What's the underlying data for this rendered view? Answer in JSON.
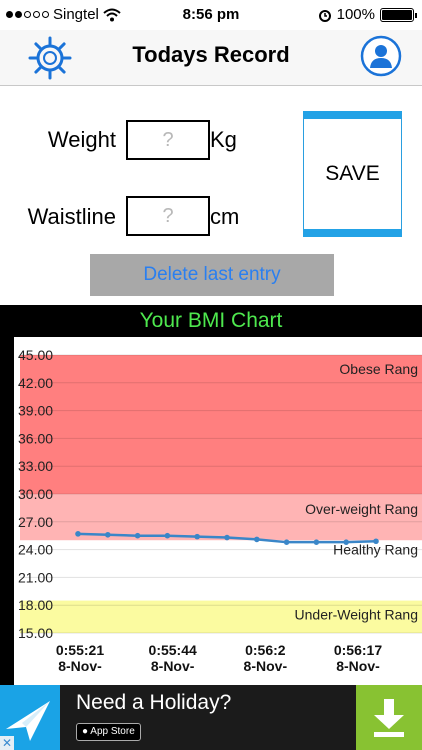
{
  "status_bar": {
    "carrier": "Singtel",
    "time": "8:56 pm",
    "battery": "100%"
  },
  "nav": {
    "title": "Todays Record",
    "left_icon": "settings-gear-icon",
    "right_icon": "user-profile-icon"
  },
  "form": {
    "weight_label": "Weight",
    "weight_placeholder": "?",
    "weight_value": "",
    "weight_unit": "Kg",
    "waist_label": "Waistline",
    "waist_placeholder": "?",
    "waist_value": "",
    "waist_unit": "cm",
    "save_label": "SAVE",
    "delete_label": "Delete last entry"
  },
  "chart_panel_title": "Your BMI Chart",
  "chart_data": {
    "type": "line",
    "title": "Your BMI Chart",
    "ylim": [
      15,
      45
    ],
    "yticks": [
      "45.00",
      "42.00",
      "39.00",
      "36.00",
      "33.00",
      "30.00",
      "27.00",
      "24.00",
      "21.00",
      "18.00",
      "15.00"
    ],
    "bands": [
      {
        "name": "Obese Range",
        "from": 30,
        "to": 45,
        "color": "#ff7f7f"
      },
      {
        "name": "Over-weight Range",
        "from": 25,
        "to": 30,
        "color": "#ffb4b4"
      },
      {
        "name": "Healthy Range",
        "from": 18.5,
        "to": 25,
        "color": "#ffffff"
      },
      {
        "name": "Under-Weight Range",
        "from": 15,
        "to": 18.5,
        "color": "#fbfba0"
      }
    ],
    "band_labels": [
      "Obese Rang",
      "Over-weight Rang",
      "Healthy Rang",
      "Under-Weight Rang"
    ],
    "xtick_labels": [
      {
        "time": "0:55:21",
        "date": "8-Nov-"
      },
      {
        "time": "0:55:44",
        "date": "8-Nov-"
      },
      {
        "time": "0:56:2",
        "date": "8-Nov-"
      },
      {
        "time": "0:56:17",
        "date": "8-Nov-"
      }
    ],
    "series": [
      {
        "values": [
          25.7,
          25.6,
          25.5,
          25.5,
          25.4,
          25.3,
          25.1,
          24.8,
          24.8,
          24.8,
          24.9
        ],
        "color": "#3a86c8"
      }
    ]
  },
  "ad": {
    "title": "Need a Holiday?",
    "store_label": "App Store",
    "download_icon": "download-arrow-icon",
    "close_icon": "close-x-icon",
    "brand_color": "#1aa3e6",
    "download_color": "#88c232"
  }
}
